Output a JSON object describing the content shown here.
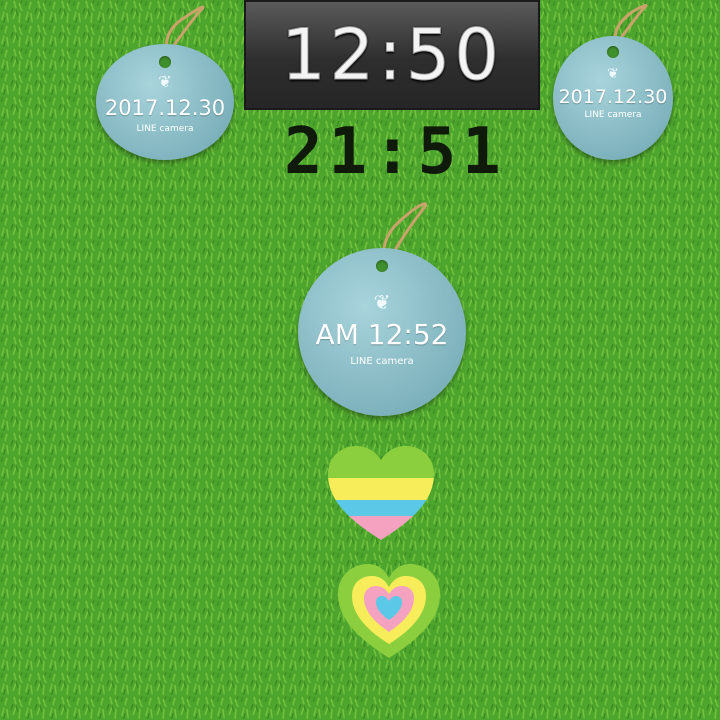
{
  "widgets": {
    "top_clock": {
      "time": "12:50"
    },
    "digital_clock": {
      "time": "21:51"
    },
    "tag_left": {
      "date": "2017.12.30",
      "brand": "LINE camera"
    },
    "tag_right": {
      "date": "2017.12.30",
      "brand": "LINE camera"
    },
    "tag_center": {
      "time": "AM 12:52",
      "brand": "LINE camera"
    }
  },
  "icons": [
    "rope-icon",
    "ornament-icon",
    "striped-heart-icon",
    "layered-heart-icon"
  ],
  "colors": {
    "grass": "#4fa52f",
    "tag_blue": "#84b8c2",
    "heart_green": "#8ccf3e",
    "heart_yellow": "#f7ec5a",
    "heart_blue": "#5cc8e8",
    "heart_pink": "#f5a2c0"
  }
}
